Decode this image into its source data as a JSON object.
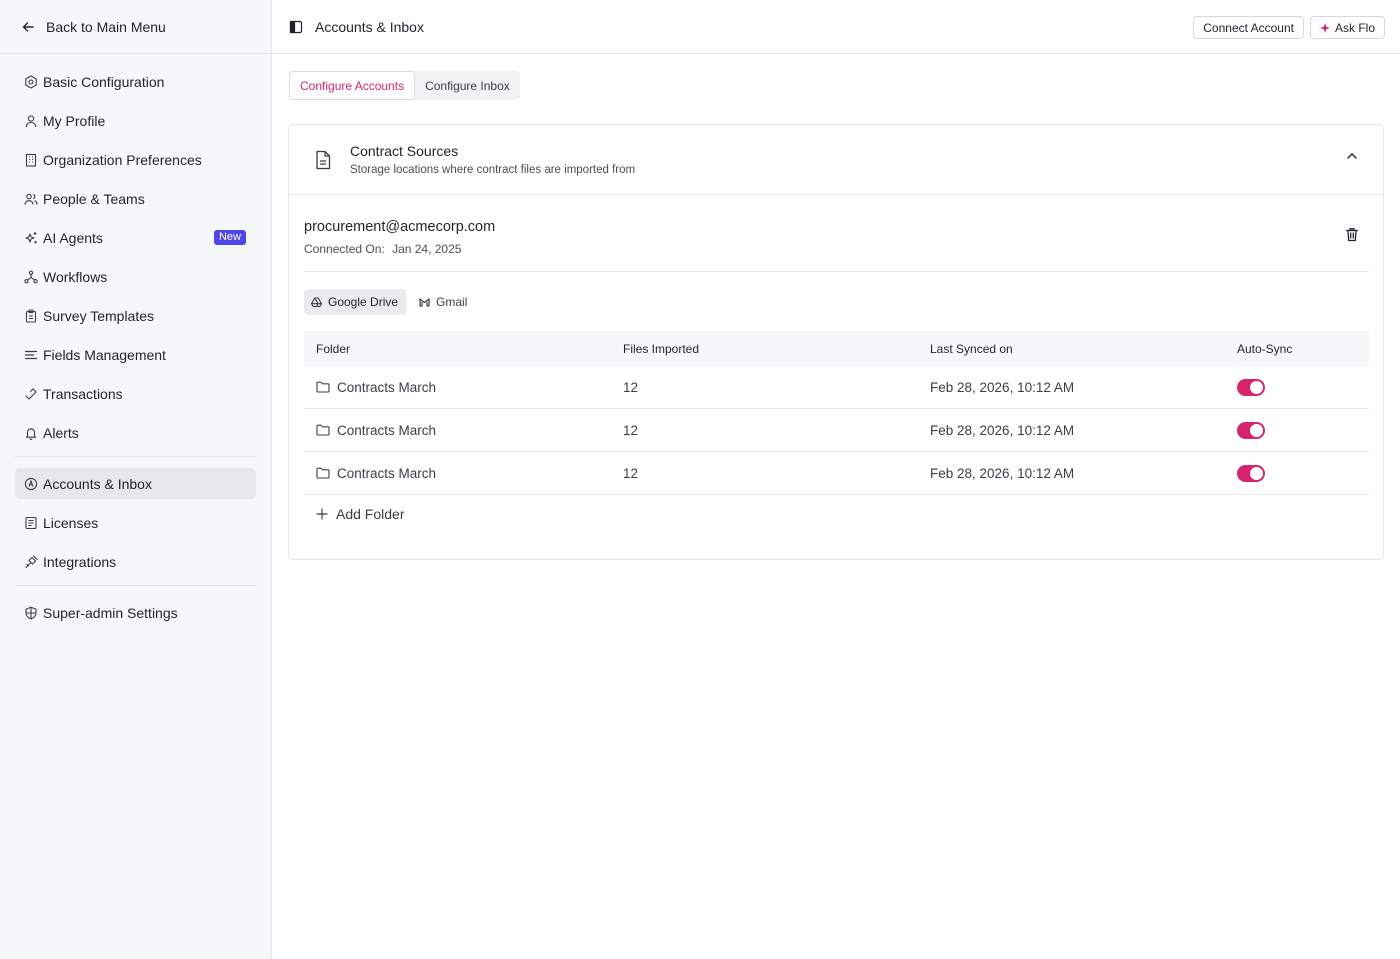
{
  "sidebar": {
    "back_label": "Back to Main Menu",
    "groups": [
      [
        {
          "label": "Basic Configuration",
          "icon": "settings-hexagon-icon"
        },
        {
          "label": "My Profile",
          "icon": "user-icon"
        },
        {
          "label": "Organization Preferences",
          "icon": "building-icon"
        },
        {
          "label": "People & Teams",
          "icon": "users-icon"
        },
        {
          "label": "AI Agents",
          "icon": "sparkles-icon",
          "badge": "New"
        },
        {
          "label": "Workflows",
          "icon": "workflow-icon"
        },
        {
          "label": "Survey Templates",
          "icon": "clipboard-icon"
        },
        {
          "label": "Fields Management",
          "icon": "list-filter-icon"
        },
        {
          "label": "Transactions",
          "icon": "arrows-swap-icon"
        },
        {
          "label": "Alerts",
          "icon": "bell-icon"
        }
      ],
      [
        {
          "label": "Accounts & Inbox",
          "icon": "at-sign-icon",
          "active": true
        },
        {
          "label": "Licenses",
          "icon": "license-icon"
        },
        {
          "label": "Integrations",
          "icon": "plug-icon"
        }
      ],
      [
        {
          "label": "Super-admin Settings",
          "icon": "shield-globe-icon"
        }
      ]
    ],
    "new_badge": "New"
  },
  "topbar": {
    "title": "Accounts & Inbox",
    "connect_label": "Connect Account",
    "ask_label": "Ask Flo"
  },
  "tabs": {
    "configure_accounts": "Configure Accounts",
    "configure_inbox": "Configure Inbox",
    "active": "configure_accounts"
  },
  "card": {
    "title": "Contract Sources",
    "subtitle": "Storage locations where contract files are imported from"
  },
  "account": {
    "email": "procurement@acmecorp.com",
    "connected_label": "Connected On:",
    "connected_date": "Jan 24, 2025"
  },
  "sources": {
    "google_drive": "Google Drive",
    "gmail": "Gmail",
    "active": "google_drive"
  },
  "table": {
    "headers": {
      "folder": "Folder",
      "files": "Files Imported",
      "synced": "Last Synced on",
      "autosync": "Auto-Sync"
    },
    "rows": [
      {
        "folder": "Contracts March",
        "files": "12",
        "synced": "Feb 28, 2026, 10:12 AM",
        "autosync": true
      },
      {
        "folder": "Contracts March",
        "files": "12",
        "synced": "Feb 28, 2026, 10:12 AM",
        "autosync": true
      },
      {
        "folder": "Contracts March",
        "files": "12",
        "synced": "Feb 28, 2026, 10:12 AM",
        "autosync": true
      }
    ],
    "add_folder_label": "Add Folder"
  },
  "colors": {
    "accent": "#d6246e",
    "badge": "#4f46e5",
    "sidebar_bg": "#f6f7f8"
  }
}
